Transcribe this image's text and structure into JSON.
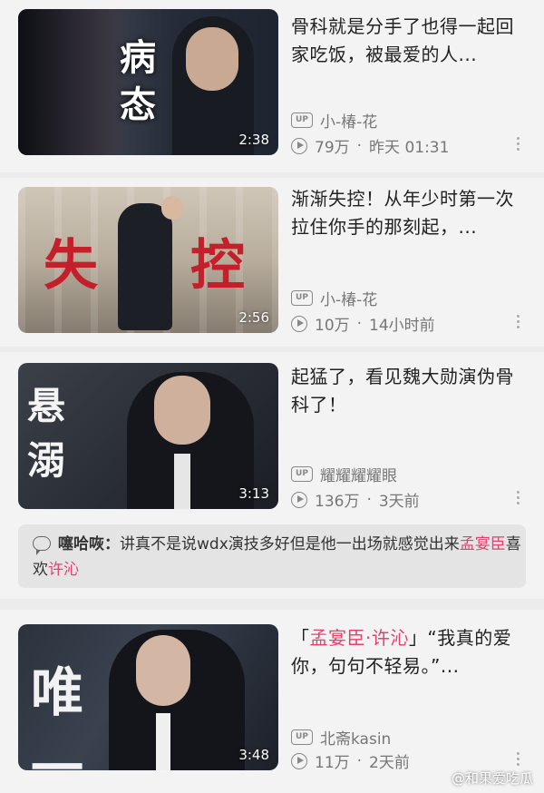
{
  "videos": [
    {
      "caption": "病态",
      "duration": "2:38",
      "title": "骨科就是分手了也得一起回家吃饭，被最爱的人...",
      "up_badge": "UP",
      "author": "小-椿-花",
      "views": "79万",
      "time": "昨天 01:31"
    },
    {
      "caption": "失控",
      "duration": "2:56",
      "title": "渐渐失控！从年少时第一次拉住你手的那刻起，...",
      "up_badge": "UP",
      "author": "小-椿-花",
      "views": "10万",
      "time": "14小时前"
    },
    {
      "caption": "悬溺",
      "duration": "3:13",
      "title": "起猛了，看见魏大勋演伪骨科了！",
      "up_badge": "UP",
      "author": "耀耀耀耀眼",
      "views": "136万",
      "time": "3天前"
    },
    {
      "caption": "唯一",
      "duration": "3:48",
      "title_parts": [
        "「",
        "孟宴臣·许沁",
        "」“我真的爱你，句句不轻易。”..."
      ],
      "up_badge": "UP",
      "author": "北斋kasin",
      "views": "11万",
      "time": "2天前"
    }
  ],
  "comment": {
    "user": "噻哈咴：",
    "text_a": "讲真不是说wdx演技多好但是他一出场就感觉出来",
    "name1": "孟宴臣",
    "text_b": "喜欢",
    "name2": "许沁"
  },
  "separator": "·",
  "watermark": "@和果爱吃瓜",
  "colors": {
    "accent": "#e5416c",
    "meta": "#777777"
  },
  "icons": [
    "up-icon",
    "play-count-icon",
    "more-vert-icon",
    "comment-icon"
  ]
}
